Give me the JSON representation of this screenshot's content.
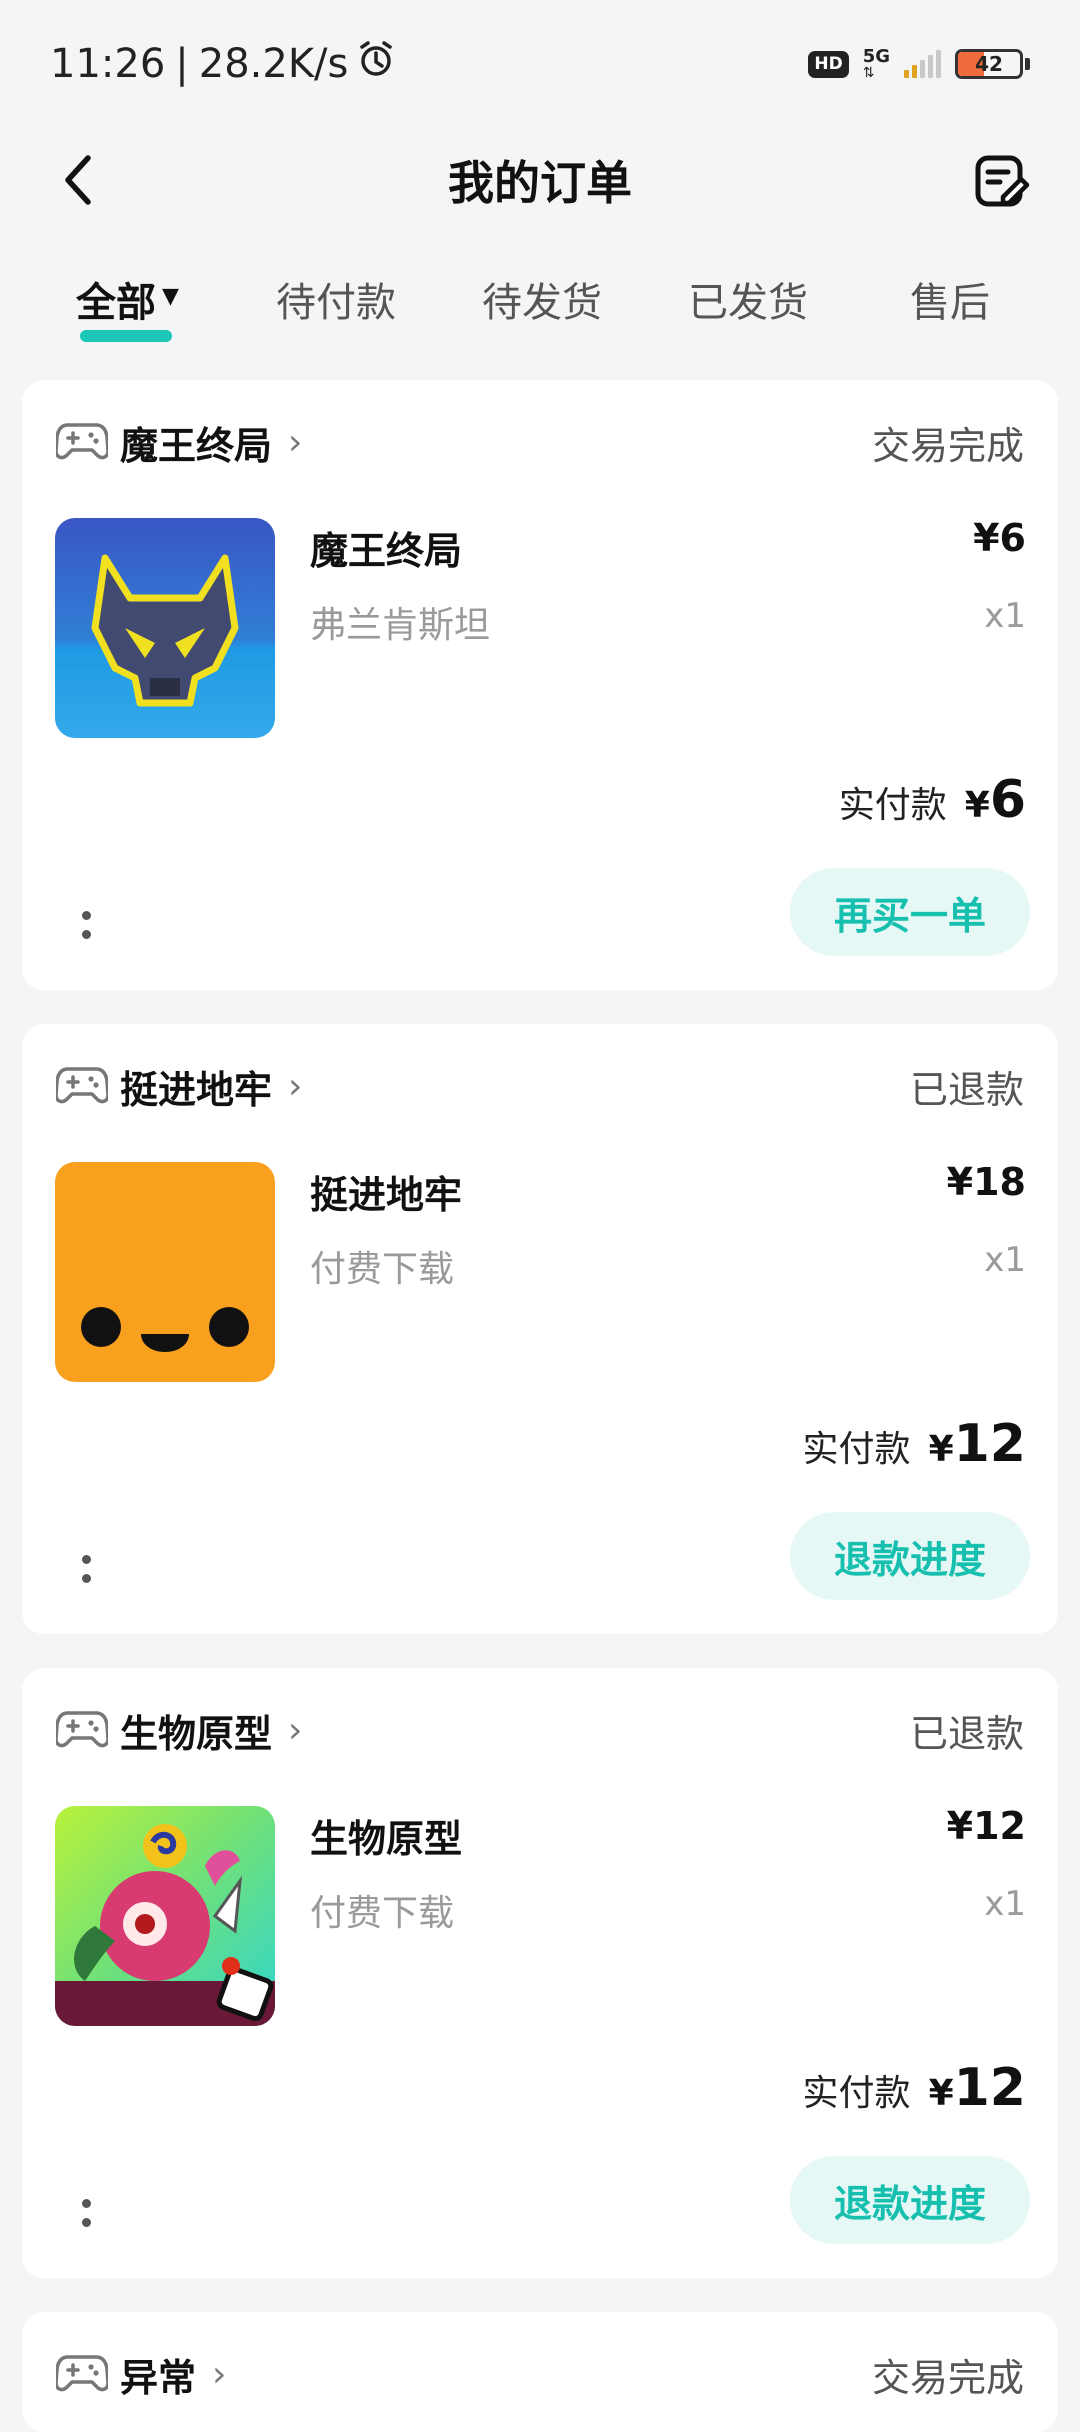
{
  "status_bar": {
    "time": "11:26",
    "separator": "|",
    "net_speed": "28.2K/s",
    "hd_badge": "HD",
    "network_type": "5G",
    "battery": "42",
    "battery_level": 0.42
  },
  "header": {
    "title": "我的订单"
  },
  "tabs": [
    {
      "label": "全部",
      "active": true
    },
    {
      "label": "待付款",
      "active": false
    },
    {
      "label": "待发货",
      "active": false
    },
    {
      "label": "已发货",
      "active": false
    },
    {
      "label": "售后",
      "active": false
    }
  ],
  "orders": [
    {
      "shop": "魔王终局",
      "status": "交易完成",
      "item_name": "魔王终局",
      "item_sub": "弗兰肯斯坦",
      "price": "¥6",
      "qty": "x1",
      "paid_label": "实付款",
      "paid_currency": "¥",
      "paid_amount": "6",
      "action": "再买一单"
    },
    {
      "shop": "挺进地牢",
      "status": "已退款",
      "item_name": "挺进地牢",
      "item_sub": "付费下载",
      "price": "¥18",
      "qty": "x1",
      "paid_label": "实付款",
      "paid_currency": "¥",
      "paid_amount": "12",
      "action": "退款进度"
    },
    {
      "shop": "生物原型",
      "status": "已退款",
      "item_name": "生物原型",
      "item_sub": "付费下载",
      "price": "¥12",
      "qty": "x1",
      "paid_label": "实付款",
      "paid_currency": "¥",
      "paid_amount": "12",
      "action": "退款进度"
    },
    {
      "shop": "异常",
      "status": "交易完成"
    }
  ],
  "colors": {
    "accent": "#1cc7b6",
    "button_bg": "#e6f8f6",
    "button_text": "#17bfae",
    "page_bg": "#f4f5f7"
  }
}
